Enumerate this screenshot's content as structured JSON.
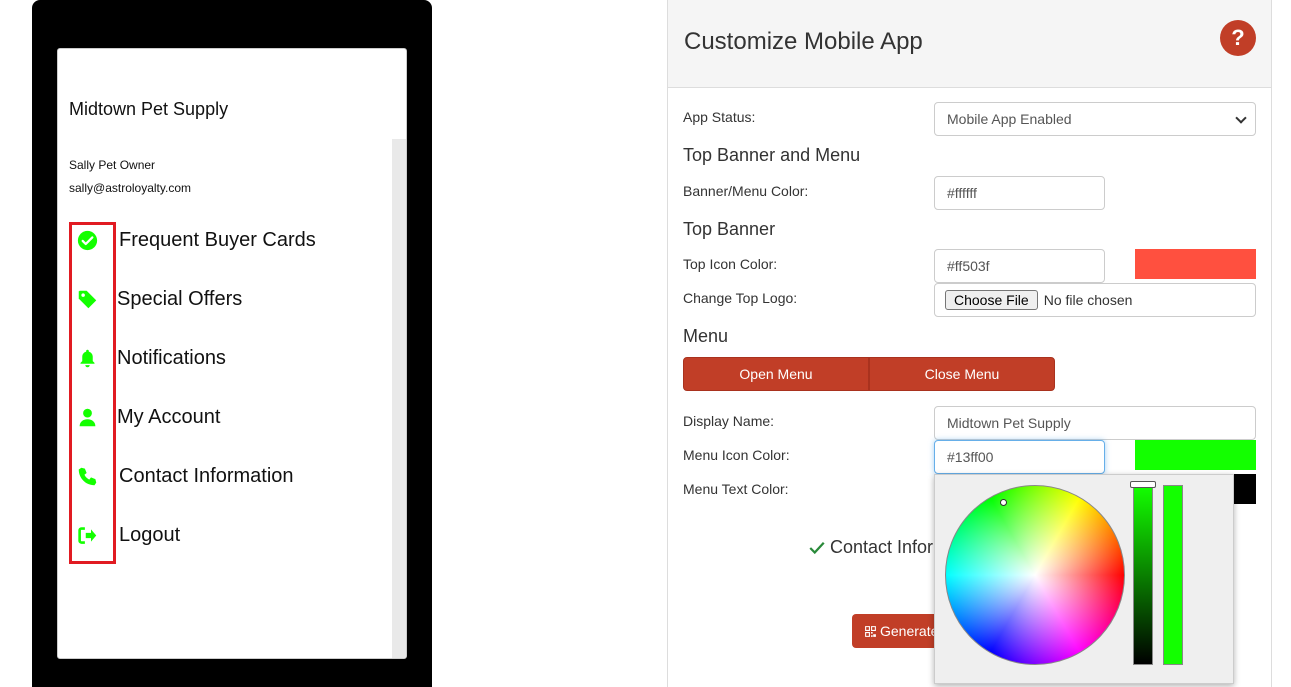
{
  "phone": {
    "store_name": "Midtown Pet Supply",
    "user_name": "Sally Pet Owner",
    "user_email": "sally@astroloyalty.com",
    "menu_icon_color": "#13ff00",
    "menu_items": [
      {
        "label": "Frequent Buyer Cards",
        "icon": "check-circle-icon"
      },
      {
        "label": "Special Offers",
        "icon": "tag-icon"
      },
      {
        "label": "Notifications",
        "icon": "bell-icon"
      },
      {
        "label": "My Account",
        "icon": "user-icon"
      },
      {
        "label": "Contact Information",
        "icon": "phone-icon"
      },
      {
        "label": "Logout",
        "icon": "sign-out-icon"
      }
    ]
  },
  "panel": {
    "title": "Customize Mobile App",
    "help": "?",
    "app_status_label": "App Status:",
    "app_status_value": "Mobile App Enabled",
    "section_top_banner_menu": "Top Banner and Menu",
    "banner_menu_color_label": "Banner/Menu Color:",
    "banner_menu_color_value": "#ffffff",
    "section_top_banner": "Top Banner",
    "top_icon_color_label": "Top Icon Color:",
    "top_icon_color_value": "#ff503f",
    "change_top_logo_label": "Change Top Logo:",
    "choose_file": "Choose File",
    "no_file": "No file chosen",
    "section_menu": "Menu",
    "open_menu": "Open Menu",
    "close_menu": "Close Menu",
    "display_name_label": "Display Name:",
    "display_name_value": "Midtown Pet Supply",
    "menu_icon_color_label": "Menu Icon Color:",
    "menu_icon_color_value": "#13ff00",
    "menu_text_color_label": "Menu Text Color:",
    "contact_info": "Contact Infor",
    "generate": "Generate"
  },
  "colors": {
    "accent": "#c13e27",
    "top_icon": "#ff503f",
    "menu_icon": "#13ff00",
    "menu_text": "#000000",
    "highlight_box": "#e11b22"
  }
}
